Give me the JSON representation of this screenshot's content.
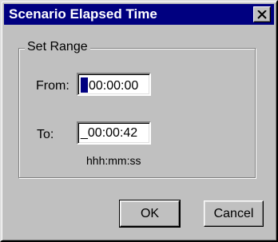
{
  "window": {
    "title": "Scenario Elapsed Time"
  },
  "group": {
    "legend": "Set Range"
  },
  "from": {
    "label": "From:",
    "value": "00:00:00"
  },
  "to": {
    "label": "To:",
    "value": "_00:00:42"
  },
  "format_hint": "hhh:mm:ss",
  "buttons": {
    "ok": "OK",
    "cancel": "Cancel"
  },
  "icons": {
    "close": "close-icon"
  },
  "colors": {
    "titlebar": "#000080",
    "face": "#c0c0c0",
    "selection": "#000080"
  }
}
